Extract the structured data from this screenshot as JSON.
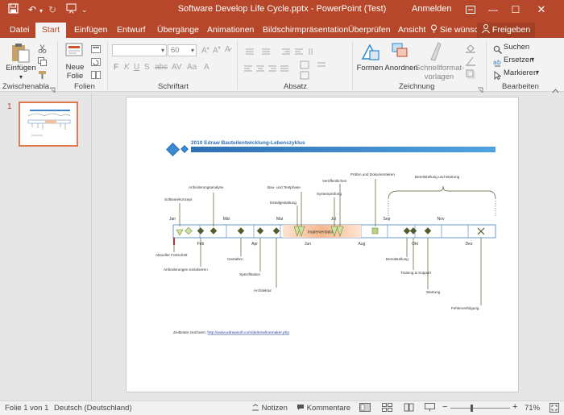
{
  "window": {
    "title": "Software Develop Life Cycle.pptx - PowerPoint (Test)",
    "signin": "Anmelden",
    "accent": "#b7472a"
  },
  "tabs": [
    {
      "label": "Datei"
    },
    {
      "label": "Start"
    },
    {
      "label": "Einfügen"
    },
    {
      "label": "Entwurf"
    },
    {
      "label": "Übergänge"
    },
    {
      "label": "Animationen"
    },
    {
      "label": "Bildschirmpräsentation"
    },
    {
      "label": "Überprüfen"
    },
    {
      "label": "Ansicht"
    },
    {
      "label": "Sie wünsc"
    },
    {
      "label": "Freigeben"
    }
  ],
  "ribbon": {
    "paste_label": "Einfügen",
    "new_slide_label": "Neue Folie",
    "font_size": "60",
    "shapes_label": "Formen",
    "arrange_label": "Anordnen",
    "quickstyles_label": "Schnellformat- vorlagen",
    "find_label": "Suchen",
    "replace_label": "Ersetzen",
    "select_label": "Markieren",
    "groups": {
      "clipboard": "Zwischenabla...",
      "slides": "Folien",
      "font": "Schriftart",
      "paragraph": "Absatz",
      "drawing": "Zeichnung",
      "editing": "Bearbeiten"
    }
  },
  "thumbnails": [
    {
      "number": "1"
    }
  ],
  "slide": {
    "title": "2010 Edraw Bauteilentwicklung-Lebenszyklus",
    "footer_prefix": "Zeitleiste zeichnen: ",
    "footer_link": "http://www.edrawsoft.com/de/timelinemaker.php",
    "implementation_label": "Implementation",
    "release_label": "Bereitstellung und Wartung",
    "months_top": [
      "Jan",
      "Mär",
      "Mai",
      "Jul",
      "Sep",
      "Nov"
    ],
    "months_bottom": [
      "Feb",
      "Apr",
      "Jun",
      "Aug",
      "Okt",
      "Dez"
    ],
    "events_above": [
      "Softwarekonzept",
      "Anforderungsanalyse",
      "Bau- und Testphase",
      "Detailgestaltung",
      "Veröffentlichen",
      "Systemprüfung",
      "Prüfen und Dokumentieren"
    ],
    "events_below": [
      "Aktueller Fortschritt",
      "Anforderungen extrahieren",
      "Gestalten",
      "Spezifikation",
      "Architektur",
      "Bereitstellung",
      "Training & Support",
      "Wartung",
      "Fehlerverfolgung"
    ]
  },
  "status": {
    "slide_info": "Folie 1 von 1",
    "language": "Deutsch (Deutschland)",
    "notes": "Notizen",
    "comments": "Kommentare",
    "zoom": "71%"
  }
}
